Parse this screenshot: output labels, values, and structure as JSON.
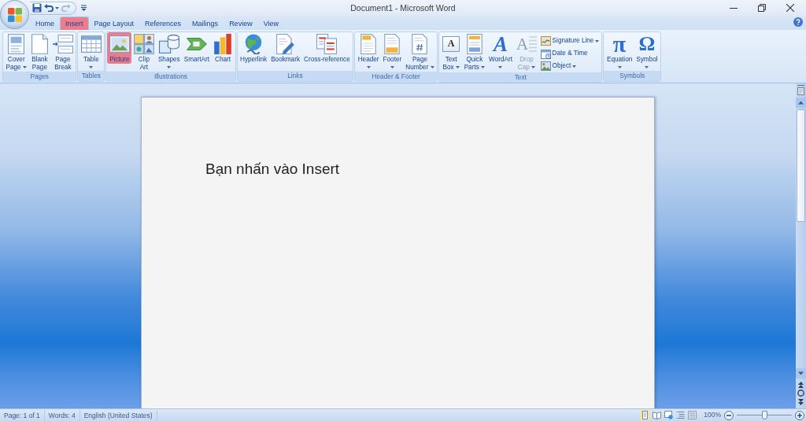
{
  "window": {
    "title": "Document1 - Microsoft Word"
  },
  "quick_access": [
    {
      "kind": "save",
      "disabled": false,
      "dropdown": false
    },
    {
      "kind": "undo",
      "disabled": false,
      "dropdown": true
    },
    {
      "kind": "redo",
      "disabled": true,
      "dropdown": false
    }
  ],
  "tabs": [
    {
      "label": "Home",
      "selected": false,
      "highlighted": false
    },
    {
      "label": "Insert",
      "selected": true,
      "highlighted": true
    },
    {
      "label": "Page Layout",
      "selected": false,
      "highlighted": false
    },
    {
      "label": "References",
      "selected": false,
      "highlighted": false
    },
    {
      "label": "Mailings",
      "selected": false,
      "highlighted": false
    },
    {
      "label": "Review",
      "selected": false,
      "highlighted": false
    },
    {
      "label": "View",
      "selected": false,
      "highlighted": false
    }
  ],
  "ribbon": {
    "groups": [
      {
        "label": "Pages",
        "buttons": [
          {
            "kind": "large",
            "label": "Cover\nPage",
            "dropdown": true,
            "disabled": false,
            "highlighted": false
          },
          {
            "kind": "large",
            "label": "Blank\nPage",
            "dropdown": false,
            "disabled": false,
            "highlighted": false
          },
          {
            "kind": "large",
            "label": "Page\nBreak",
            "dropdown": false,
            "disabled": false,
            "highlighted": false
          }
        ]
      },
      {
        "label": "Tables",
        "buttons": [
          {
            "kind": "large",
            "label": "Table",
            "dropdown": true,
            "disabled": false,
            "highlighted": false
          }
        ]
      },
      {
        "label": "Illustrations",
        "buttons": [
          {
            "kind": "large",
            "label": "Picture",
            "dropdown": false,
            "disabled": false,
            "highlighted": true
          },
          {
            "kind": "large",
            "label": "Clip\nArt",
            "dropdown": false,
            "disabled": false,
            "highlighted": false
          },
          {
            "kind": "large",
            "label": "Shapes",
            "dropdown": true,
            "disabled": false,
            "highlighted": false
          },
          {
            "kind": "large",
            "label": "SmartArt",
            "dropdown": false,
            "disabled": false,
            "highlighted": false
          },
          {
            "kind": "large",
            "label": "Chart",
            "dropdown": false,
            "disabled": false,
            "highlighted": false
          }
        ]
      },
      {
        "label": "Links",
        "buttons": [
          {
            "kind": "large",
            "label": "Hyperlink",
            "dropdown": false,
            "disabled": false,
            "highlighted": false
          },
          {
            "kind": "large",
            "label": "Bookmark",
            "dropdown": false,
            "disabled": false,
            "highlighted": false
          },
          {
            "kind": "large",
            "label": "Cross-reference",
            "dropdown": false,
            "disabled": false,
            "highlighted": false
          }
        ]
      },
      {
        "label": "Header & Footer",
        "buttons": [
          {
            "kind": "large",
            "label": "Header",
            "dropdown": true,
            "disabled": false,
            "highlighted": false
          },
          {
            "kind": "large",
            "label": "Footer",
            "dropdown": true,
            "disabled": false,
            "highlighted": false
          },
          {
            "kind": "large",
            "label": "Page\nNumber",
            "dropdown": true,
            "disabled": false,
            "highlighted": false
          }
        ]
      },
      {
        "label": "Text",
        "buttons": [
          {
            "kind": "large",
            "label": "Text\nBox",
            "glyph": "A",
            "dropdown": true,
            "disabled": false,
            "highlighted": false
          },
          {
            "kind": "large",
            "label": "Quick\nParts",
            "dropdown": true,
            "disabled": false,
            "highlighted": false
          },
          {
            "kind": "large",
            "label": "WordArt",
            "glyph": "A",
            "dropdown": true,
            "disabled": false,
            "highlighted": false
          },
          {
            "kind": "large",
            "label": "Drop\nCap",
            "glyph": "A",
            "dropdown": true,
            "disabled": true,
            "highlighted": false
          },
          {
            "kind": "small",
            "label": "Signature Line",
            "dropdown": true,
            "disabled": false,
            "highlighted": false
          },
          {
            "kind": "small",
            "label": "Date & Time",
            "dropdown": false,
            "disabled": false,
            "highlighted": false
          },
          {
            "kind": "small",
            "label": "Object",
            "dropdown": true,
            "disabled": false,
            "highlighted": false
          }
        ]
      },
      {
        "label": "Symbols",
        "buttons": [
          {
            "kind": "large",
            "label": "Equation",
            "glyph": "π",
            "dropdown": true,
            "disabled": false,
            "highlighted": false
          },
          {
            "kind": "large",
            "label": "Symbol",
            "glyph": "Ω",
            "dropdown": true,
            "disabled": false,
            "highlighted": false
          }
        ]
      }
    ]
  },
  "document": {
    "paragraphs": [
      "Bạn nhấn vào Insert"
    ]
  },
  "status_bar": {
    "items": [
      "Page: 1 of 1",
      "Words: 4",
      "English (United States)"
    ],
    "views": [
      {
        "selected": true
      },
      {
        "selected": false
      },
      {
        "selected": false
      },
      {
        "selected": false
      },
      {
        "selected": false
      }
    ],
    "zoom": {
      "label": "100%",
      "level": 0.5
    }
  }
}
